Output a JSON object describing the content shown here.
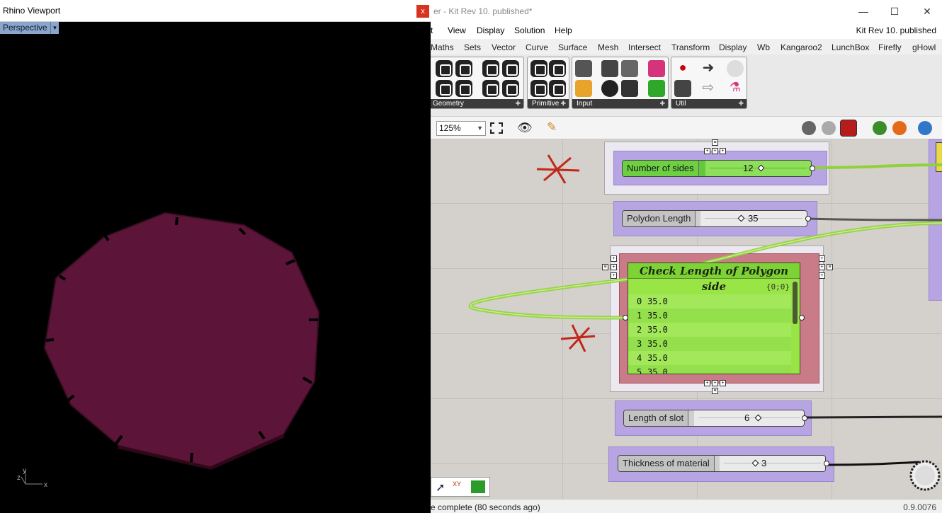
{
  "rhino": {
    "title": "Rhino Viewport",
    "close": "x",
    "view_label": "Perspective",
    "axis_z": "z",
    "axis_y": "y",
    "axis_x": "x",
    "shape_color": "#5c1538"
  },
  "gh": {
    "title": "er - Kit Rev 10. published*",
    "win_minimize": "—",
    "win_maximize": "☐",
    "win_close": "✕",
    "menu": [
      "t",
      "View",
      "Display",
      "Solution",
      "Help"
    ],
    "doc_name": "Kit Rev 10. published",
    "tabs": [
      "Maths",
      "Sets",
      "Vector",
      "Curve",
      "Surface",
      "Mesh",
      "Intersect",
      "Transform",
      "Display",
      "Wb",
      "Kangaroo2",
      "LunchBox",
      "Firefly",
      "gHowl"
    ],
    "ribbon_groups": [
      "Geometry",
      "Primitive",
      "Input",
      "Util"
    ],
    "zoom": "125%",
    "canvas": {
      "sliders": [
        {
          "name": "Number of sides",
          "value": "12"
        },
        {
          "name": "Polydon Length",
          "value": "35"
        },
        {
          "name": "Length of slot",
          "value": "6"
        },
        {
          "name": "Thickness of material",
          "value": "3"
        }
      ],
      "panel": {
        "title": "Check Length of Polygon side",
        "path": "{0;0}",
        "rows": [
          {
            "i": "0",
            "v": "35.0"
          },
          {
            "i": "1",
            "v": "35.0"
          },
          {
            "i": "2",
            "v": "35.0"
          },
          {
            "i": "3",
            "v": "35.0"
          },
          {
            "i": "4",
            "v": "35.0"
          },
          {
            "i": "5",
            "v": "35.0"
          }
        ]
      }
    },
    "status": "e complete (80 seconds ago)",
    "version": "0.9.0076",
    "colors": {
      "wire": "#8fd13a",
      "canvas": "#d4d0cb",
      "group": "#b7a4e2",
      "panel": "#99e546",
      "annotation": "#c0281a"
    }
  }
}
